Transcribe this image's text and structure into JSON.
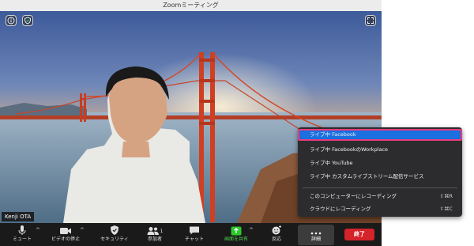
{
  "window": {
    "title": "Zoomミーティング"
  },
  "participant": {
    "name": "Kenji OTA"
  },
  "menu": {
    "items": [
      {
        "label": "ライブ中 Facebook",
        "shortcut": "",
        "highlighted": true
      },
      {
        "label": "ライブ中 FacebookのWorkplace",
        "shortcut": ""
      },
      {
        "label": "ライブ中 YouTube",
        "shortcut": ""
      },
      {
        "label": "ライブ中 カスタムライブストリーム配信サービス",
        "shortcut": ""
      },
      {
        "label": "このコンピューターにレコーディング",
        "shortcut": "⇧⌘R"
      },
      {
        "label": "クラウドにレコーディング",
        "shortcut": "⇧⌘C"
      }
    ]
  },
  "toolbar": {
    "mute_label": "ミュート",
    "video_label": "ビデオの停止",
    "security_label": "セキュリティ",
    "participants_label": "参加者",
    "participants_count": "1",
    "chat_label": "チャット",
    "share_label": "画面を共有",
    "reactions_label": "反応",
    "more_label": "詳細",
    "end_label": "終了"
  },
  "colors": {
    "accent": "#1b6fe0",
    "highlight_border": "#e73b7a",
    "share_green": "#2cc92c",
    "end_red": "#d4232a",
    "toolbar_bg": "#1a1a1a"
  }
}
